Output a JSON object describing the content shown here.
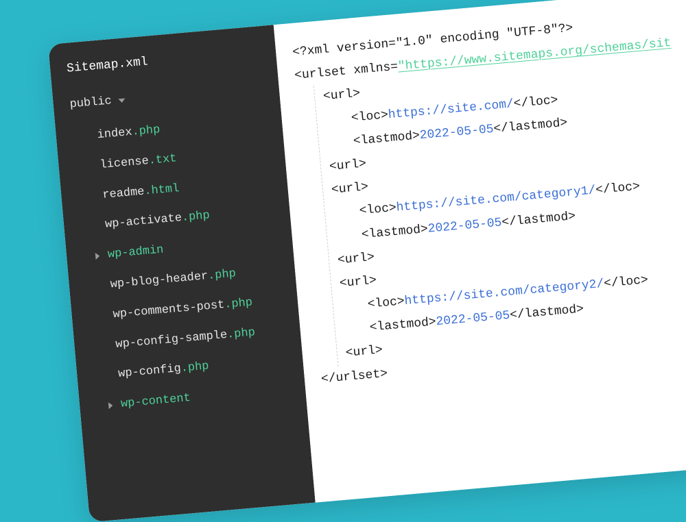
{
  "sidebar": {
    "title": "Sitemap.xml",
    "root_folder": "public",
    "items": [
      {
        "base": "index",
        "ext": "php",
        "type": "file"
      },
      {
        "base": "license",
        "ext": "txt",
        "type": "file"
      },
      {
        "base": "readme",
        "ext": "html",
        "type": "file"
      },
      {
        "base": "wp-activate",
        "ext": "php",
        "type": "file"
      },
      {
        "base": "wp-admin",
        "ext": "",
        "type": "folder"
      },
      {
        "base": "wp-blog-header",
        "ext": "php",
        "type": "file"
      },
      {
        "base": "wp-comments-post",
        "ext": "php",
        "type": "file"
      },
      {
        "base": "wp-config-sample",
        "ext": "php",
        "type": "file"
      },
      {
        "base": "wp-config",
        "ext": "php",
        "type": "file"
      },
      {
        "base": "wp-content",
        "ext": "",
        "type": "folder"
      }
    ]
  },
  "code": {
    "xml_decl": "<?xml version=\"1.0\" encoding \"UTF-8\"?>",
    "urlset_open_pre": "<urlset xmlns=",
    "urlset_open_url": "\"https://www.sitemaps.org/schemas/sit",
    "url_open": "<url>",
    "url_close": "<url>",
    "loc_open": "<loc>",
    "loc_close": "</loc>",
    "lastmod_open": "<lastmod>",
    "lastmod_close": "</lastmod>",
    "urlset_close": "</urlset>",
    "entries": [
      {
        "loc": "https://site.com/",
        "lastmod": "2022-05-05"
      },
      {
        "loc": "https://site.com/category1/",
        "lastmod": "2022-05-05"
      },
      {
        "loc": "https://site.com/category2/",
        "lastmod": "2022-05-05"
      }
    ]
  }
}
